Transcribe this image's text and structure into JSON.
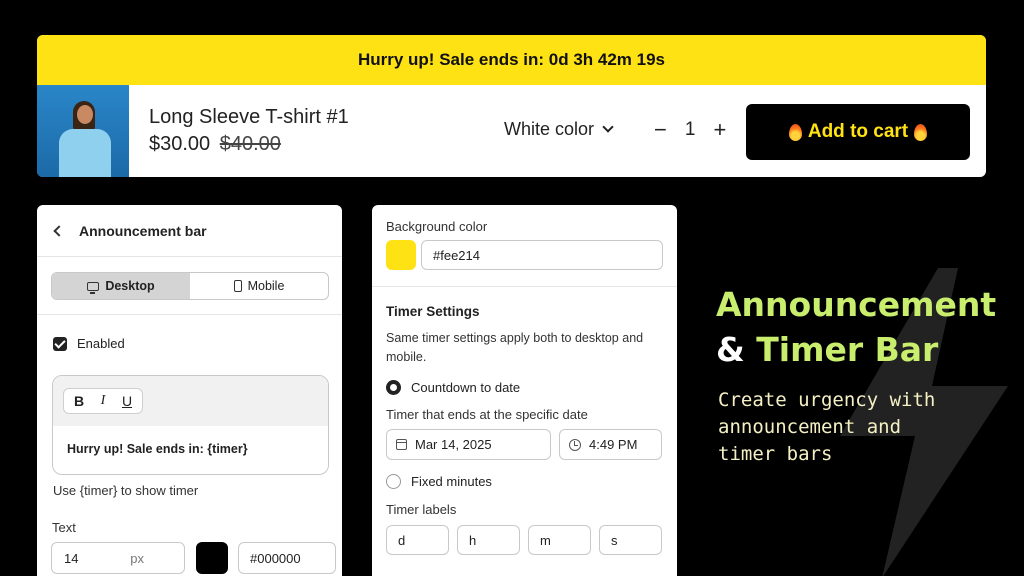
{
  "announcement": {
    "text": "Hurry up! Sale ends in: 0d 3h 42m 19s"
  },
  "product": {
    "name": "Long Sleeve T-shirt #1",
    "price": "$30.00",
    "compare_price": "$40.00",
    "variant": "White color",
    "quantity": "1",
    "minus": "−",
    "plus": "+",
    "cart_label": "Add to cart"
  },
  "settings_panel": {
    "title": "Announcement bar",
    "tabs": [
      {
        "label": "Desktop",
        "icon": "desktop-icon",
        "active": true
      },
      {
        "label": "Mobile",
        "icon": "mobile-icon",
        "active": false
      }
    ],
    "enabled_label": "Enabled",
    "format_buttons": [
      "B",
      "I",
      "U"
    ],
    "editor_text": "Hurry up! Sale ends in: {timer}",
    "hint": "Use {timer} to show timer",
    "text_label": "Text",
    "font_size": "14",
    "font_unit": "px",
    "text_color": "#000000"
  },
  "timer_panel": {
    "bg_label": "Background color",
    "bg_color": "#fee214",
    "section_title": "Timer Settings",
    "description": "Same timer settings apply both to desktop and mobile.",
    "option_countdown": "Countdown to date",
    "date_label": "Timer that ends at the specific date",
    "date": "Mar 14, 2025",
    "time": "4:49 PM",
    "option_fixed": "Fixed minutes",
    "labels_title": "Timer labels",
    "labels": [
      "d",
      "h",
      "m",
      "s"
    ]
  },
  "promo": {
    "title_line1": "Announcement",
    "title_amp": "&",
    "title_line2": "Timer Bar",
    "subtitle": "Create urgency with announcement and timer bars"
  },
  "colors": {
    "accent_yellow": "#fee214",
    "promo_green": "#c9ee6e",
    "background": "#000000"
  }
}
